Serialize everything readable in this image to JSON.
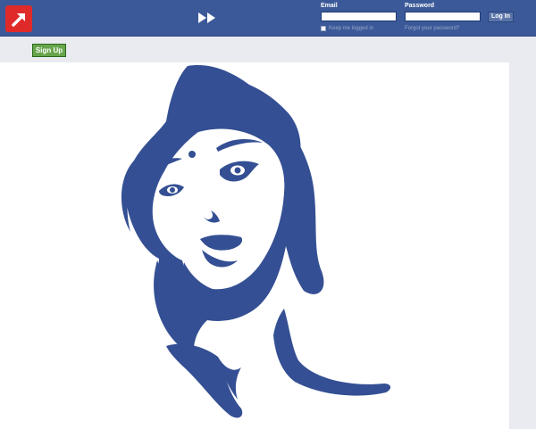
{
  "header": {
    "logo_icon": "red-diagonal-arrow-icon",
    "center_icon": "fast-forward-icon",
    "brand_color": "#3b5998",
    "login": {
      "email_label": "Email",
      "password_label": "Password",
      "email_value": "",
      "password_value": "",
      "keep_logged_in_label": "Keep me logged in",
      "keep_logged_in_checked": false,
      "forgot_password_link": "Forgot your password?",
      "login_button_label": "Log In"
    }
  },
  "actions": {
    "signup_button_label": "Sign Up",
    "signup_color": "#67a54b"
  },
  "main": {
    "illustration_icon": "woman-portrait-illustration",
    "illustration_color": "#344f93"
  }
}
